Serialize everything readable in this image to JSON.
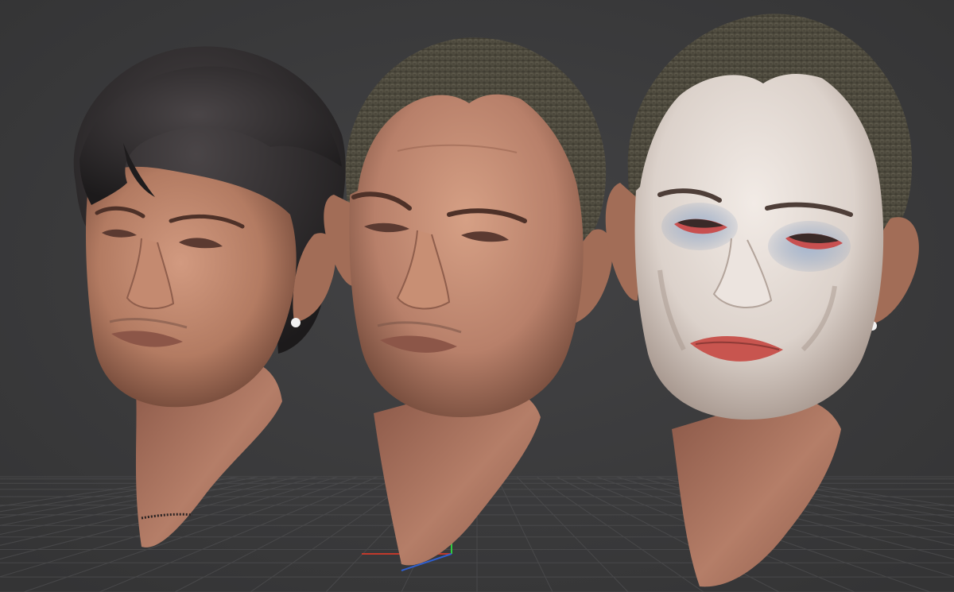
{
  "viewport": {
    "background_color": "#3a3a3b",
    "grid_color": "#505052",
    "axis_x_color": "#c0392b",
    "axis_y_color": "#2ecc40",
    "axis_z_color": "#2f5fd0"
  },
  "heads": [
    {
      "name": "head-with-hair",
      "skin_color": "#b37b62",
      "hair_color": "#2b2829",
      "earring_color": "#f2f2f2"
    },
    {
      "name": "head-buzzcut",
      "skin_color": "#b8806a",
      "hair_color": "#5a5648",
      "earring_color": "#f2f2f2"
    },
    {
      "name": "head-clown-makeup",
      "skin_color": "#b8806a",
      "hair_color": "#5a5648",
      "face_paint_color": "#e4dcd6",
      "eye_paint_color": "#8fa3c0",
      "lip_paint_color": "#c8554f",
      "earring_color": "#f2f2f2"
    }
  ]
}
